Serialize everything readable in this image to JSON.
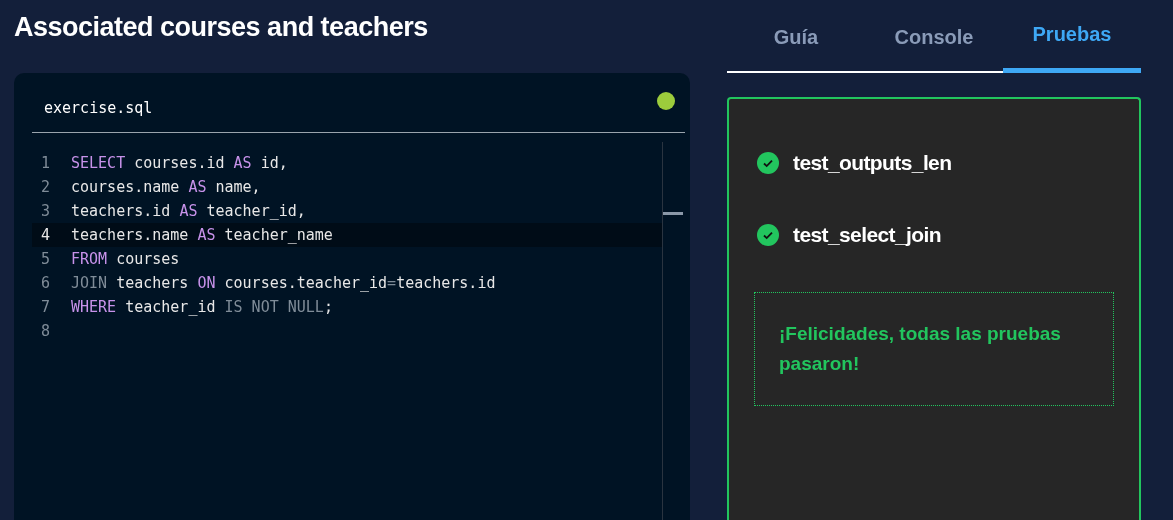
{
  "title": "Associated courses and teachers",
  "editor": {
    "filename": "exercise.sql",
    "saved": true,
    "lines": [
      {
        "number": "1",
        "current": false,
        "tokens": [
          {
            "kind": "keyword",
            "text": "SELECT"
          },
          {
            "kind": "ident",
            "text": " courses.id "
          },
          {
            "kind": "keyword",
            "text": "AS"
          },
          {
            "kind": "ident",
            "text": " id,"
          }
        ]
      },
      {
        "number": "2",
        "current": false,
        "tokens": [
          {
            "kind": "ident",
            "text": "courses.name "
          },
          {
            "kind": "keyword",
            "text": "AS"
          },
          {
            "kind": "ident",
            "text": " name,"
          }
        ]
      },
      {
        "number": "3",
        "current": false,
        "tokens": [
          {
            "kind": "ident",
            "text": "teachers.id "
          },
          {
            "kind": "keyword",
            "text": "AS"
          },
          {
            "kind": "ident",
            "text": " teacher_id,"
          }
        ]
      },
      {
        "number": "4",
        "current": true,
        "tokens": [
          {
            "kind": "ident",
            "text": "teachers.name "
          },
          {
            "kind": "keyword",
            "text": "AS"
          },
          {
            "kind": "ident",
            "text": " teacher_name"
          }
        ]
      },
      {
        "number": "5",
        "current": false,
        "tokens": [
          {
            "kind": "keyword",
            "text": "FROM"
          },
          {
            "kind": "ident",
            "text": " courses"
          }
        ]
      },
      {
        "number": "6",
        "current": false,
        "tokens": [
          {
            "kind": "muted",
            "text": "JOIN"
          },
          {
            "kind": "ident",
            "text": " teachers "
          },
          {
            "kind": "keyword",
            "text": "ON"
          },
          {
            "kind": "ident",
            "text": " courses.teacher_id"
          },
          {
            "kind": "muted",
            "text": "="
          },
          {
            "kind": "ident",
            "text": "teachers.id"
          }
        ]
      },
      {
        "number": "7",
        "current": false,
        "tokens": [
          {
            "kind": "keyword",
            "text": "WHERE"
          },
          {
            "kind": "ident",
            "text": " teacher_id "
          },
          {
            "kind": "muted",
            "text": "IS NOT NULL"
          },
          {
            "kind": "ident",
            "text": ";"
          }
        ]
      },
      {
        "number": "8",
        "current": false
      }
    ]
  },
  "tabs": [
    {
      "label": "Guía",
      "selected": false
    },
    {
      "label": "Console",
      "selected": false
    },
    {
      "label": "Pruebas",
      "selected": true
    }
  ],
  "tests": [
    {
      "name": "test_outputs_len",
      "passed": true
    },
    {
      "name": "test_select_join",
      "passed": true
    }
  ],
  "result_message": "¡Felicidades, todas las pruebas pasaron!"
}
